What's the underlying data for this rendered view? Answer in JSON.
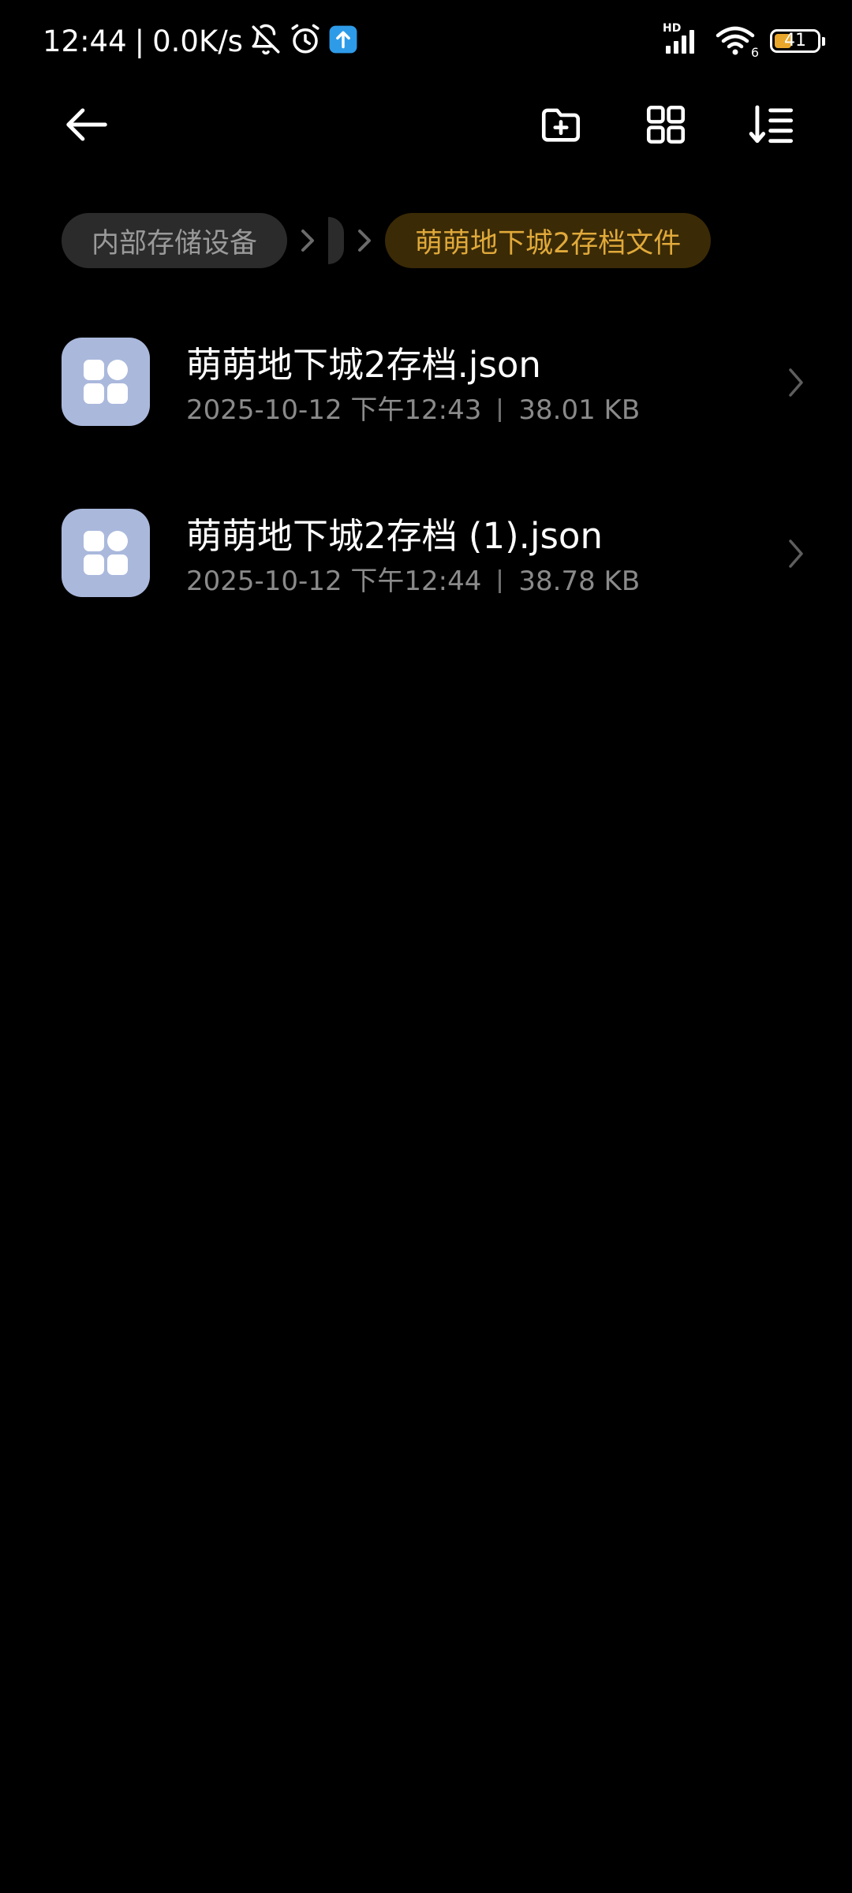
{
  "status_bar": {
    "time": "12:44",
    "divider": "|",
    "net_speed": "0.0K/s",
    "hd_label": "HD",
    "signal_sub": "6",
    "battery_level": "41",
    "battery_fill_fraction": 0.41,
    "icons": [
      "bell-off-icon",
      "alarm-icon",
      "upload-app-icon",
      "signal-icon",
      "wifi-icon",
      "battery-icon"
    ]
  },
  "toolbar": {
    "back_icon": "arrow-left-icon",
    "new_folder_icon": "folder-plus-icon",
    "view_mode_icon": "grid-view-icon",
    "sort_icon": "sort-icon"
  },
  "breadcrumb": {
    "root": "内部存储设备",
    "current": "萌萌地下城2存档文件"
  },
  "files": [
    {
      "name": "萌萌地下城2存档.json",
      "date": "2025-10-12 下午12:43",
      "size": "38.01 KB"
    },
    {
      "name": "萌萌地下城2存档 (1).json",
      "date": "2025-10-12 下午12:44",
      "size": "38.78 KB"
    }
  ],
  "colors": {
    "background": "#000000",
    "accent": "#e0a93a",
    "file_icon_bg": "#aab8dc",
    "secondary_text": "#8a8a8a"
  }
}
